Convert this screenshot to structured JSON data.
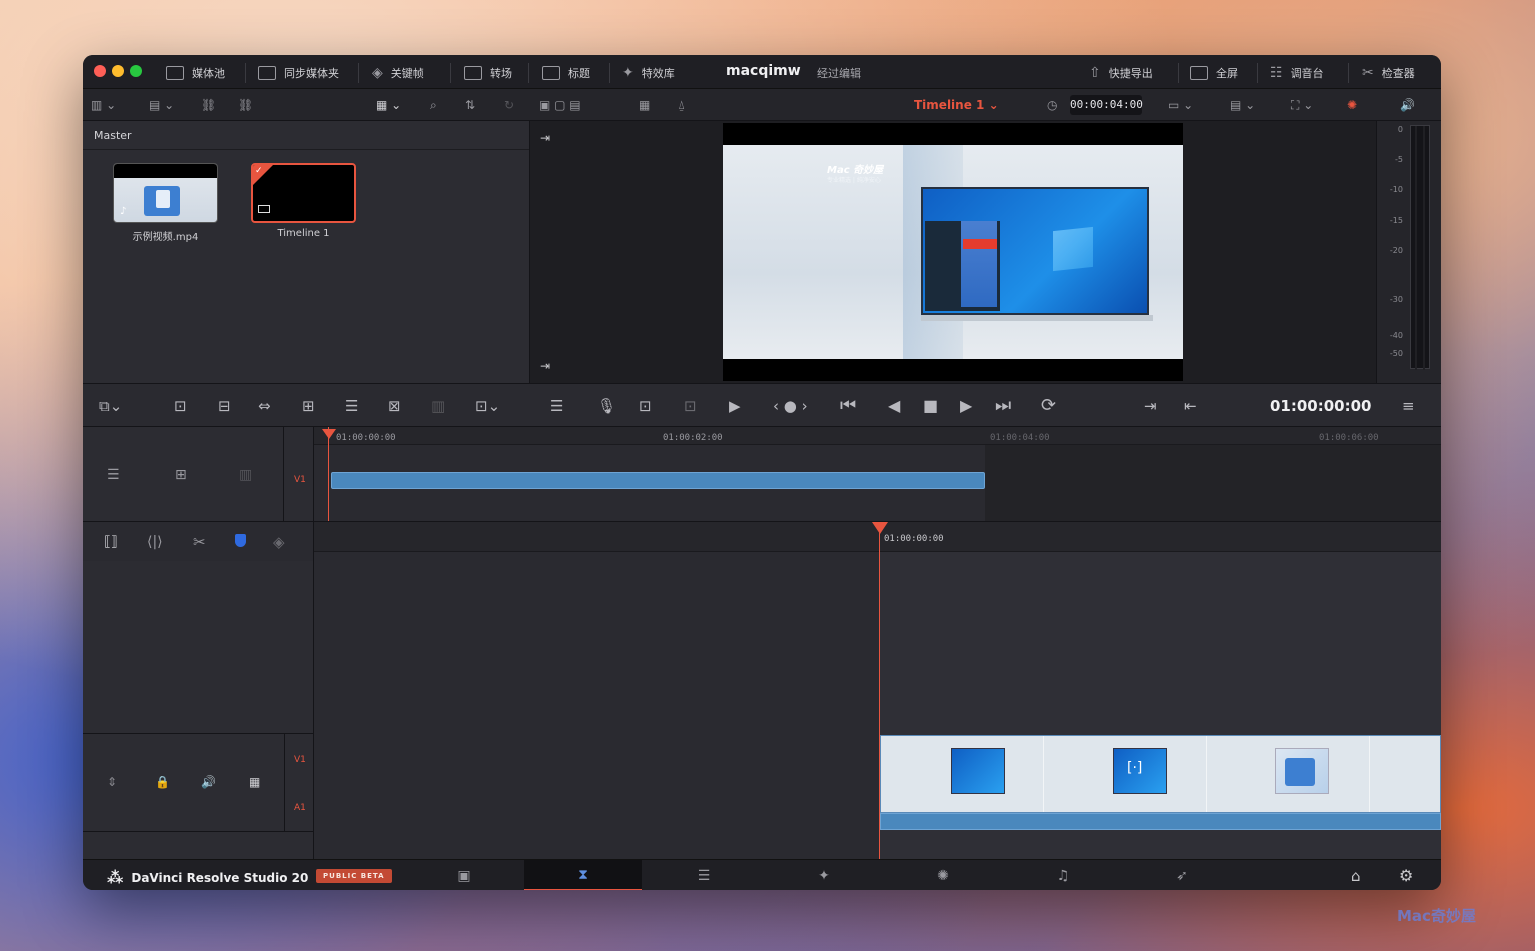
{
  "window": {
    "project_name": "macqimw",
    "project_subtitle": "经过编辑"
  },
  "top_tabs": [
    {
      "label": "媒体池",
      "icon": "media-pool-icon"
    },
    {
      "label": "同步媒体夹",
      "icon": "sync-bin-icon"
    },
    {
      "label": "关键帧",
      "icon": "keyframe-icon"
    },
    {
      "label": "转场",
      "icon": "transition-icon"
    },
    {
      "label": "标题",
      "icon": "title-icon"
    },
    {
      "label": "特效库",
      "icon": "effects-icon"
    }
  ],
  "right_tabs": [
    {
      "label": "快捷导出",
      "icon": "export-icon"
    },
    {
      "label": "全屏",
      "icon": "fullscreen-icon"
    },
    {
      "label": "调音台",
      "icon": "mixer-icon"
    },
    {
      "label": "检查器",
      "icon": "inspector-icon"
    }
  ],
  "viewer": {
    "timeline_name": "Timeline 1",
    "duration_tc": "00:00:04:00",
    "current_tc": "01:00:00:00",
    "watermark_text": "Mac 奇妙屋",
    "watermark_sub": "专业精选 | 纯净安心"
  },
  "media_pool": {
    "bin_name": "Master",
    "clips": [
      {
        "label": "示例视频.mp4"
      },
      {
        "label": "Timeline 1"
      }
    ]
  },
  "audio_meter": {
    "labels": [
      "0",
      "-5",
      "-10",
      "-15",
      "-20",
      "-30",
      "-40",
      "-50"
    ]
  },
  "upper_ruler": [
    "01:00:00:00",
    "01:00:02:00",
    "01:00:04:00",
    "01:00:06:00"
  ],
  "lower_ruler": [
    "01:00:00:00"
  ],
  "tracks": {
    "upper_video": "V1",
    "lower_video": "V1",
    "lower_audio": "A1"
  },
  "bottom": {
    "brand": "DaVinci Resolve Studio 20",
    "beta": "PUBLIC BETA"
  },
  "corner_watermark": "Mac奇妙屋",
  "colors": {
    "accent_red": "#e8553f",
    "clip_blue": "#4a88bd",
    "active_tab_blue": "#5f8fe0"
  }
}
